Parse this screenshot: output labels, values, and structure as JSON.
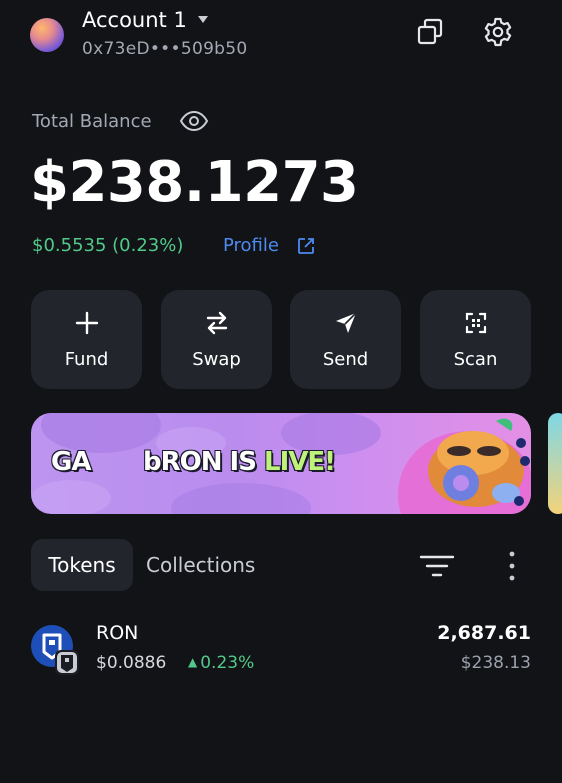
{
  "header": {
    "account_name": "Account 1",
    "address": "0x73eD•••509b50",
    "icons": [
      "chevron-down-icon",
      "copy-icon",
      "gear-icon"
    ]
  },
  "balance": {
    "label": "Total Balance",
    "value": "$238.1273",
    "change": "$0.5535 (0.23%)",
    "profile_label": "Profile"
  },
  "actions": [
    {
      "label": "Fund",
      "icon": "plus-icon"
    },
    {
      "label": "Swap",
      "icon": "swap-icon"
    },
    {
      "label": "Send",
      "icon": "send-icon"
    },
    {
      "label": "Scan",
      "icon": "scan-icon"
    }
  ],
  "banner": {
    "logo_text": "GA",
    "title_prefix": "bRON IS ",
    "title_highlight": "LIVE!"
  },
  "tabs": {
    "tokens": "Tokens",
    "collections": "Collections"
  },
  "tokens": [
    {
      "symbol": "RON",
      "price": "$0.0886",
      "change": "0.23%",
      "amount": "2,687.61",
      "value": "$238.13"
    }
  ],
  "colors": {
    "background": "#111317",
    "surface": "#22252c",
    "positive": "#52c98a",
    "link": "#4d8af0",
    "muted": "#a3a8b3"
  }
}
